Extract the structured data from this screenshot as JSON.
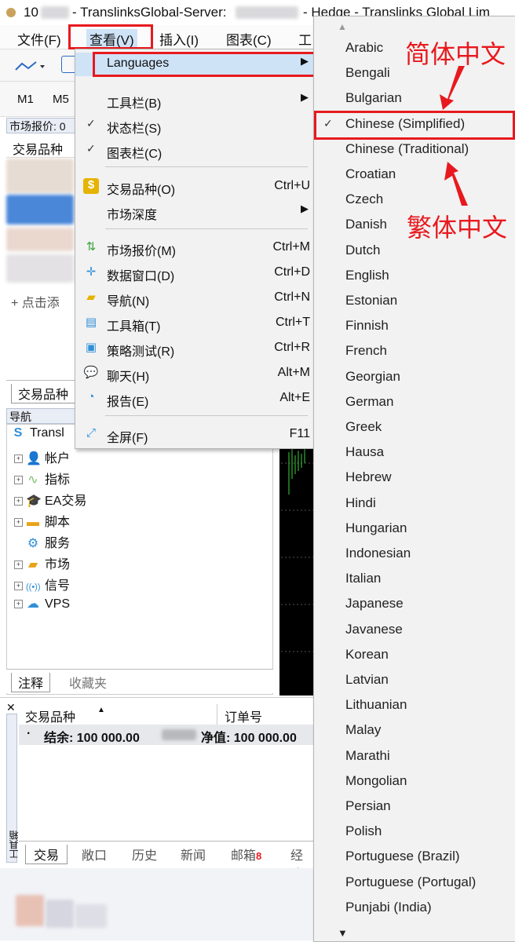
{
  "window": {
    "title_prefix": "10",
    "title_server": "- TranslinksGlobal-Server:",
    "title_suffix": "- Hedge - Translinks Global Lim"
  },
  "menubar": {
    "items": [
      "文件(F)",
      "查看(V)",
      "插入(I)",
      "图表(C)",
      "工"
    ]
  },
  "toolbar": {
    "timeframes": [
      "M1",
      "M5"
    ]
  },
  "market_watch": {
    "header": "市场报价: 0",
    "column": "交易品种",
    "add_label": "+ 点击添",
    "tab": "交易品种"
  },
  "navigator": {
    "header": "导航",
    "root": "Transl",
    "items": [
      "帐户",
      "指标",
      "EA交易",
      "脚本",
      "服务",
      "市场",
      "信号",
      "VPS"
    ],
    "tabs": [
      "注释",
      "收藏夹"
    ]
  },
  "view_menu": {
    "languages": "Languages",
    "items": [
      {
        "label": "工具栏(B)",
        "shortcut": ""
      },
      {
        "label": "状态栏(S)",
        "shortcut": ""
      },
      {
        "label": "图表栏(C)",
        "shortcut": ""
      },
      {
        "label": "交易品种(O)",
        "shortcut": "Ctrl+U"
      },
      {
        "label": "市场深度",
        "shortcut": ""
      },
      {
        "label": "市场报价(M)",
        "shortcut": "Ctrl+M"
      },
      {
        "label": "数据窗口(D)",
        "shortcut": "Ctrl+D"
      },
      {
        "label": "导航(N)",
        "shortcut": "Ctrl+N"
      },
      {
        "label": "工具箱(T)",
        "shortcut": "Ctrl+T"
      },
      {
        "label": "策略测试(R)",
        "shortcut": "Ctrl+R"
      },
      {
        "label": "聊天(H)",
        "shortcut": "Alt+M"
      },
      {
        "label": "报告(E)",
        "shortcut": "Alt+E"
      },
      {
        "label": "全屏(F)",
        "shortcut": "F11"
      }
    ]
  },
  "languages": [
    "Arabic",
    "Bengali",
    "Bulgarian",
    "Chinese (Simplified)",
    "Chinese (Traditional)",
    "Croatian",
    "Czech",
    "Danish",
    "Dutch",
    "English",
    "Estonian",
    "Finnish",
    "French",
    "Georgian",
    "German",
    "Greek",
    "Hausa",
    "Hebrew",
    "Hindi",
    "Hungarian",
    "Indonesian",
    "Italian",
    "Japanese",
    "Javanese",
    "Korean",
    "Latvian",
    "Lithuanian",
    "Malay",
    "Marathi",
    "Mongolian",
    "Persian",
    "Polish",
    "Portuguese (Brazil)",
    "Portuguese (Portugal)",
    "Punjabi (India)"
  ],
  "selected_language": "Chinese (Simplified)",
  "annotations": {
    "simplified": "简体中文",
    "traditional": "繁体中文"
  },
  "toolbox": {
    "side_label": "工具箱",
    "col_symbol": "交易品种",
    "col_order": "订单号",
    "balance": "结余: 100 000.00",
    "equity": "净值: 100 000.00",
    "tabs": [
      "交易",
      "敞口",
      "历史",
      "新闻",
      "邮箱",
      "经济"
    ],
    "mail_count": "8"
  },
  "colors": {
    "highlight": "#cfe3f7",
    "annotation_red": "#e8191e",
    "selected_item": "#cfe3f7"
  }
}
